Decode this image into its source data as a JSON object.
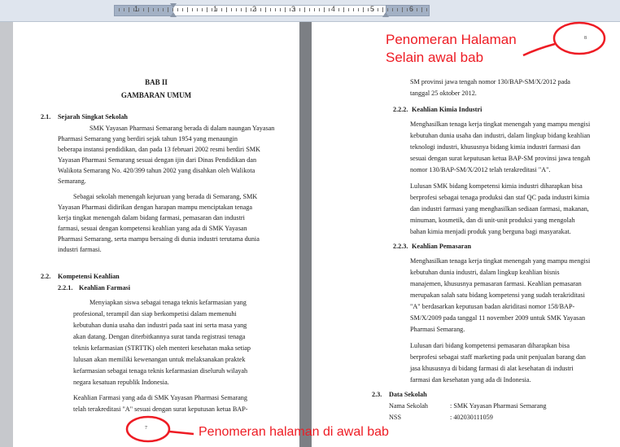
{
  "ruler": {
    "numbers": [
      "1",
      "1",
      "2",
      "3",
      "4",
      "5",
      "6"
    ]
  },
  "left_page": {
    "chapter": "BAB II",
    "chapter_title": "GAMBARAN UMUM",
    "s21_num": "2.1.",
    "s21_title": "Sejarah Singkat Sekolah",
    "s21_p1": [
      "SMK Yayasan Pharmasi Semarang berada di dalam naungan Yayasan",
      "Pharmasi Semarang yang berdiri sejak tahun 1954 yang menaungin",
      "beberapa instansi pendidikan, dan pada 13 februari 2002 resmi berdiri SMK",
      "Yayasan Pharmasi Semarang sesuai dengan ijin dari Dinas Pendidikan dan",
      "Walikota Semarang No. 420/399 tahun 2002 yang disahkan oleh Walikota",
      "Semarang."
    ],
    "s21_p2": [
      "Sebagai sekolah menengah kejuruan yang berada di Semarang, SMK",
      "Yayasan Pharmasi didirikan dengan harapan mampu menciptakan tenaga",
      "kerja tingkat menengah dalam bidang farmasi, pemasaran dan industri",
      "farmasi, sesuai dengan kompetensi keahlian yang ada di SMK Yayasan",
      "Pharmasi Semarang, serta mampu bersaing di dunia industri terutama dunia",
      "industri farmasi."
    ],
    "s22_num": "2.2.",
    "s22_title": "Kompetensi Keahlian",
    "s221_num": "2.2.1.",
    "s221_title": "Keahlian Farmasi",
    "s221_p1": [
      "Menyiapkan siswa sebagai tenaga teknis kefarmasian yang",
      "profesional, terampil dan siap berkompetisi dalam memenuhi",
      "kebutuhan dunia usaha dan industri pada saat ini serta masa yang",
      "akan datang. Dengan diterbitkannya surat tanda registrasi tenaga",
      "teknis kefarmasian (STRTTK) oleh menteri kesehatan maka setiap",
      "lulusan akan memiliki kewenangan untuk melaksanakan praktek",
      "kefarmasian sebagai tenaga teknis kefarmasian diseluruh wilayah",
      "negara kesatuan republik Indonesia."
    ],
    "s221_p2": [
      "Keahlian Farmasi yang ada di SMK Yayasan Pharmasi Semarang",
      "telah terakreditasi \"A\" sesuai dengan surat keputusan ketua BAP-"
    ],
    "page_number": "7"
  },
  "right_page": {
    "cont_line1": "SM provinsi jawa tengah nomor 130/BAP-SM/X/2012 pada",
    "cont_line2": "tanggal 25 oktober 2012.",
    "s222_num": "2.2.2.",
    "s222_title": "Keahlian Kimia Industri",
    "s222_p1": [
      "Menghasilkan tenaga kerja tingkat menengah yang mampu mengisi",
      "kebutuhan dunia usaha dan industri, dalam lingkup bidang keahlian",
      "teknologi industri, khususnya bidang kimia industri farmasi dan",
      "sesuai dengan surat keputusan ketua BAP-SM provinsi jawa tengah",
      "nomor 130/BAP-SM/X/2012 telah terakreditasi \"A\"."
    ],
    "s222_p2": [
      "Lulusan SMK bidang kompetensi kimia industri diharapkan bisa",
      "berprofesi sebagai tenaga produksi dan staf QC pada industri kimia",
      "dan industri farmasi yang menghasilkan sediaan farmasi, makanan,",
      "minuman, kosmetik, dan di unit-unit produksi yang mengolah",
      "bahan kimia menjadi produk yang berguna bagi masyarakat."
    ],
    "s223_num": "2.2.3.",
    "s223_title": "Keahlian Pemasaran",
    "s223_p1": [
      "Menghasilkan tenaga kerja tingkat menengah yang mampu mengisi",
      "kebutuhan dunia industri, dalam lingkup keahlian bisnis",
      "manajemen, khususnya pemasaran farmasi. Keahlian pemasaran",
      "merupakan salah satu bidang kompetensi yang sudah terakriditasi",
      "\"A\" berdasarkan keputusan badan akriditasi nomor 158/BAP-",
      "SM/X/2009 pada tanggal 11 november 2009 untuk SMK Yayasan",
      "Pharmasi Semarang."
    ],
    "s223_p2": [
      "Lulusan dari bidang kompetensi pemasaran diharapkan bisa",
      "berprofesi sebagai staff marketing pada unit penjualan barang dan",
      "jasa khususnya di bidang farmasi di alat kesehatan di industri",
      "farmasi dan kesehatan yang ada di Indonesia."
    ],
    "s23_num": "2.3.",
    "s23_title": "Data Sekolah",
    "nama_label": "Nama Sekolah",
    "nama_value": ": SMK Yayasan Pharmasi Semarang",
    "nss_label": "NSS",
    "nss_value": ": 402030111059",
    "page_number": "8"
  },
  "annotations": {
    "top_right_line1": "Penomeran Halaman",
    "top_right_line2": "Selain awal bab",
    "bottom": "Penomeran halaman di awal bab",
    "color": "#ee1c24"
  }
}
